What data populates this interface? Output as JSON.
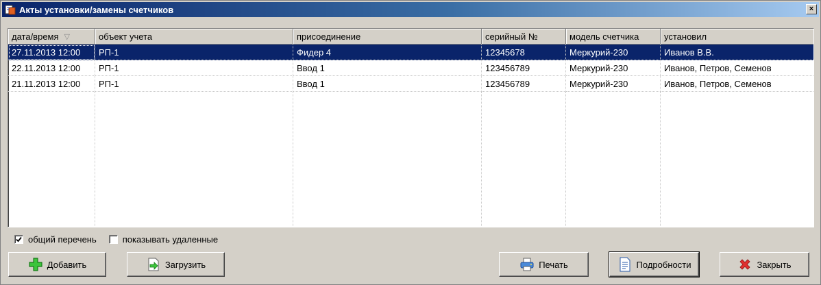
{
  "window": {
    "title": "Акты установки/замены счетчиков",
    "close_label": "×"
  },
  "grid": {
    "columns": [
      "дата/время",
      "объект учета",
      "присоединение",
      "серийный №",
      "модель счетчика",
      "установил"
    ],
    "sort_indicator": "▽",
    "rows": [
      [
        "27.11.2013 12:00",
        "РП-1",
        "Фидер 4",
        "12345678",
        "Меркурий-230",
        "Иванов В.В."
      ],
      [
        "22.11.2013 12:00",
        "РП-1",
        "Ввод 1",
        "123456789",
        "Меркурий-230",
        "Иванов, Петров, Семенов"
      ],
      [
        "21.11.2013 12:00",
        "РП-1",
        "Ввод 1",
        "123456789",
        "Меркурий-230",
        "Иванов, Петров, Семенов"
      ]
    ],
    "selected_row": 0
  },
  "options": {
    "general_list": {
      "label": "общий перечень",
      "checked": true
    },
    "show_deleted": {
      "label": "показывать удаленные",
      "checked": false
    }
  },
  "buttons": {
    "add": "Добавить",
    "load": "Загрузить",
    "print": "Печать",
    "details": "Подробности",
    "close": "Закрыть"
  },
  "icons": {
    "add": "plus-icon",
    "load": "import-arrow-icon",
    "print": "printer-icon",
    "details": "document-icon",
    "close": "red-x-icon"
  },
  "colors": {
    "selection": "#0a246a",
    "title_start": "#0a246a",
    "title_end": "#a6caf0",
    "add_icon": "#22a622",
    "close_icon": "#d42020"
  }
}
